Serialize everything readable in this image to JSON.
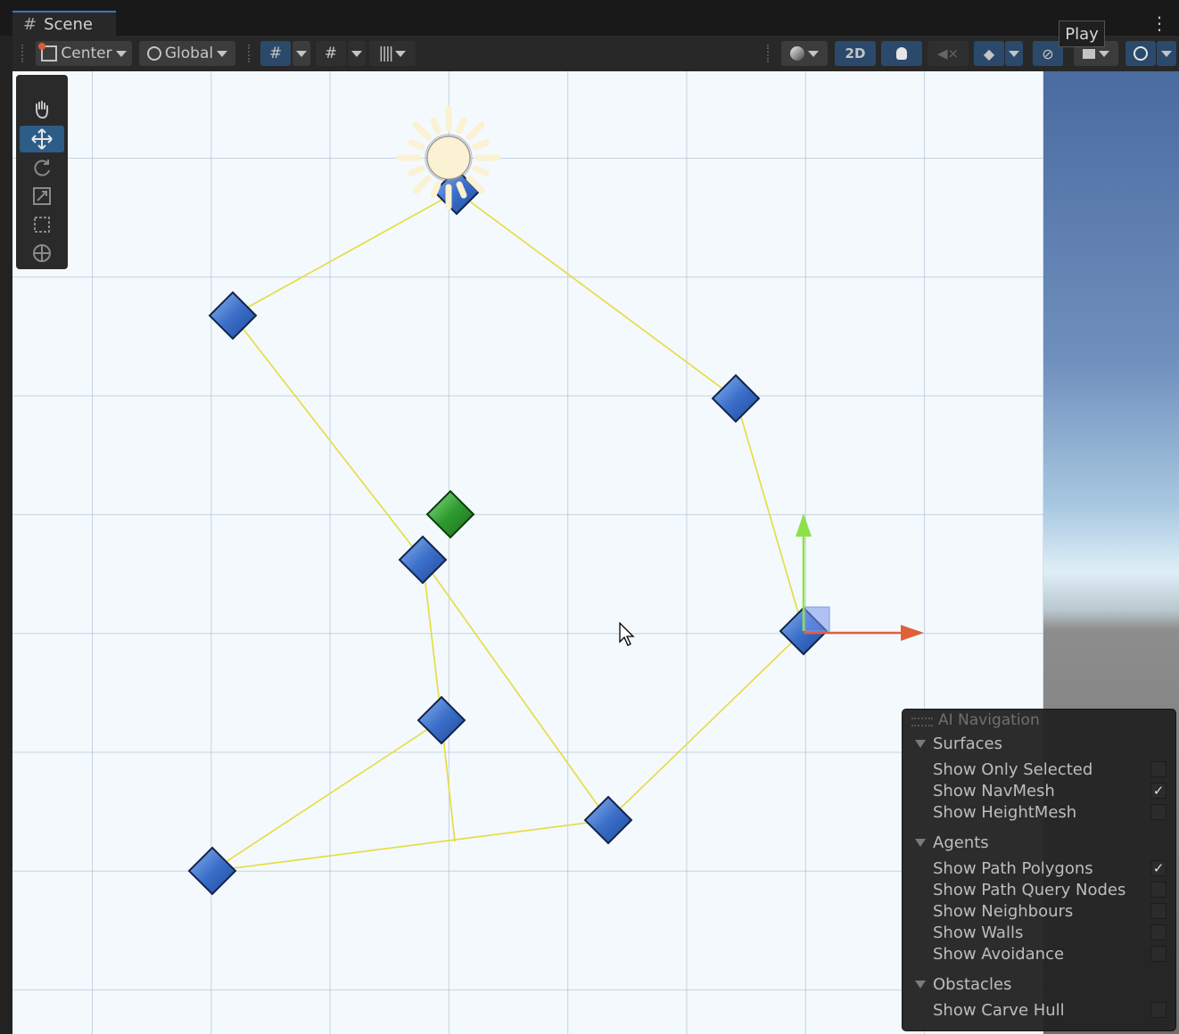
{
  "tab": {
    "title": "Scene",
    "icon": "grid-hash-icon"
  },
  "toolbar": {
    "pivot_label": "Center",
    "space_label": "Global",
    "mode_2d_label": "2D",
    "play_tooltip": "Play"
  },
  "tools": [
    "hand-tool",
    "move-tool",
    "rotate-tool",
    "scale-tool",
    "rect-tool",
    "transform-tool"
  ],
  "active_tool": "move-tool",
  "nav_panel": {
    "title": "AI Navigation",
    "sections": [
      {
        "name": "Surfaces",
        "options": [
          {
            "label": "Show Only Selected",
            "checked": false
          },
          {
            "label": "Show NavMesh",
            "checked": true
          },
          {
            "label": "Show HeightMesh",
            "checked": false
          }
        ]
      },
      {
        "name": "Agents",
        "options": [
          {
            "label": "Show Path Polygons",
            "checked": true
          },
          {
            "label": "Show Path Query Nodes",
            "checked": false
          },
          {
            "label": "Show Neighbours",
            "checked": false
          },
          {
            "label": "Show Walls",
            "checked": false
          },
          {
            "label": "Show Avoidance",
            "checked": false
          }
        ]
      },
      {
        "name": "Obstacles",
        "options": [
          {
            "label": "Show Carve Hull",
            "checked": false
          }
        ]
      }
    ]
  },
  "colors": {
    "waypoint": "#3b6fc9",
    "start_marker": "#2e9b2e",
    "path_line": "#e6dc3c",
    "gizmo_x": "#e0603a",
    "gizmo_y": "#8ee04a",
    "light_icon": "#fbf1d3"
  }
}
